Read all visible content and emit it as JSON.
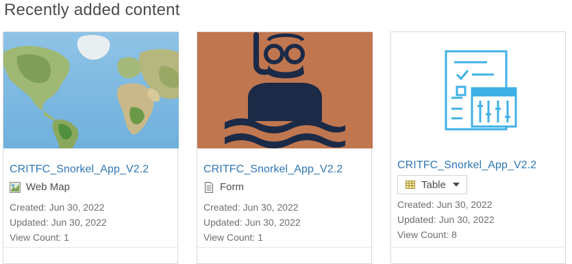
{
  "section": {
    "title": "Recently added content"
  },
  "cards": [
    {
      "title": "CRITFC_Snorkel_App_V2.2",
      "type": "Web Map",
      "icon": "web-map-icon",
      "created": "Created: Jun 30, 2022",
      "updated": "Updated: Jun 30, 2022",
      "views": "View Count: 1"
    },
    {
      "title": "CRITFC_Snorkel_App_V2.2",
      "type": "Form",
      "icon": "form-document-icon",
      "created": "Created: Jun 30, 2022",
      "updated": "Updated: Jun 30, 2022",
      "views": "View Count: 1"
    },
    {
      "title": "CRITFC_Snorkel_App_V2.2",
      "type": "Table",
      "icon": "table-icon",
      "created": "Created: Jun 30, 2022",
      "updated": "Updated: Jun 30, 2022",
      "views": "View Count: 8"
    }
  ],
  "colors": {
    "link": "#2e76b5",
    "snorkel_bg": "#c0764f",
    "snorkel_fg": "#1b2a47",
    "table_thumb": "#3fb0e6"
  }
}
